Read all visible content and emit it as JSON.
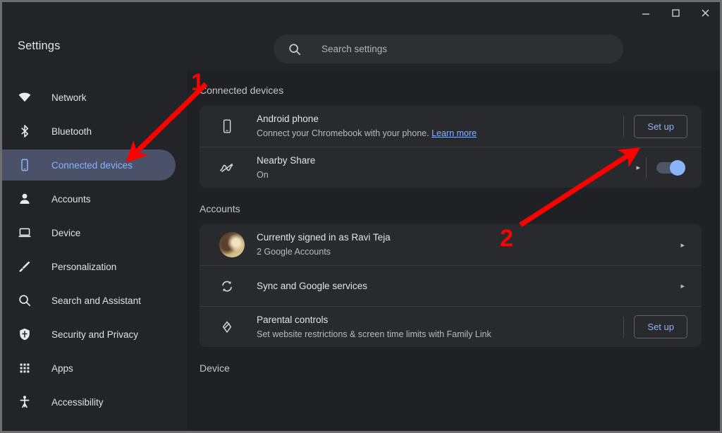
{
  "window": {
    "minimize_label": "Minimize",
    "maximize_label": "Maximize",
    "close_label": "Close"
  },
  "header": {
    "title": "Settings",
    "search": {
      "placeholder": "Search settings",
      "value": "",
      "icon": "search-icon"
    }
  },
  "sidebar": {
    "items": [
      {
        "label": "Network",
        "icon": "wifi-icon",
        "selected": false
      },
      {
        "label": "Bluetooth",
        "icon": "bluetooth-icon",
        "selected": false
      },
      {
        "label": "Connected devices",
        "icon": "phone-icon",
        "selected": true
      },
      {
        "label": "Accounts",
        "icon": "person-icon",
        "selected": false
      },
      {
        "label": "Device",
        "icon": "laptop-icon",
        "selected": false
      },
      {
        "label": "Personalization",
        "icon": "brush-icon",
        "selected": false
      },
      {
        "label": "Search and Assistant",
        "icon": "search-icon",
        "selected": false
      },
      {
        "label": "Security and Privacy",
        "icon": "shield-icon",
        "selected": false
      },
      {
        "label": "Apps",
        "icon": "grid-apps-icon",
        "selected": false
      },
      {
        "label": "Accessibility",
        "icon": "accessibility-icon",
        "selected": false
      }
    ]
  },
  "main": {
    "connected_devices": {
      "heading": "Connected devices",
      "android_phone": {
        "title": "Android phone",
        "subtitle_prefix": "Connect your Chromebook with your phone.",
        "link_label": "Learn more",
        "button_label": "Set up",
        "icon": "phone-icon"
      },
      "nearby_share": {
        "title": "Nearby Share",
        "subtitle": "On",
        "icon": "nearby-share-icon",
        "toggle_on": true,
        "chevron": "▸"
      }
    },
    "accounts": {
      "heading": "Accounts",
      "signed_in": {
        "title": "Currently signed in as Ravi Teja",
        "subtitle": "2 Google Accounts",
        "icon": "avatar",
        "chevron": "▸"
      },
      "sync": {
        "title": "Sync and Google services",
        "icon": "sync-icon",
        "chevron": "▸"
      },
      "parental_controls": {
        "title": "Parental controls",
        "subtitle": "Set website restrictions & screen time limits with Family Link",
        "icon": "family-link-icon",
        "button_label": "Set up"
      }
    },
    "device": {
      "heading": "Device"
    }
  },
  "annotations": {
    "marker_1": "1",
    "marker_2": "2",
    "color": "#fd0000"
  },
  "colors": {
    "accent_blue": "#8ab4f8",
    "selected_nav_bg": "#4a5169",
    "card_bg": "#292a2d",
    "content_bg": "#202124",
    "chrome_bg": "#232427"
  }
}
